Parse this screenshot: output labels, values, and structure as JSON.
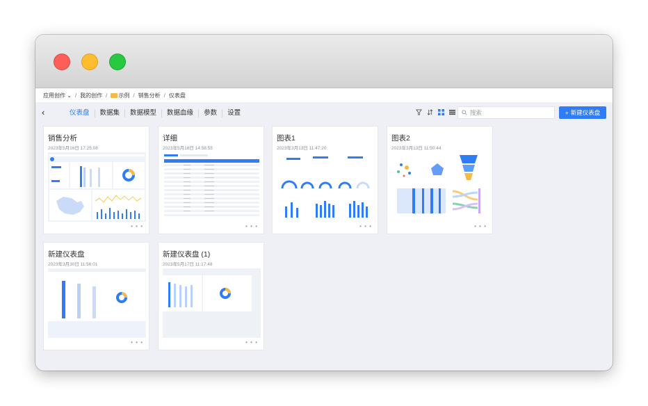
{
  "window": {
    "traffic_lights": {
      "close": "#fc5f57",
      "minimize": "#fdbd2e",
      "zoom": "#28c840"
    }
  },
  "breadcrumb": {
    "root": "应用创作",
    "items": [
      "我的创作",
      "示例",
      "销售分析",
      "仪表盘"
    ]
  },
  "toolbar": {
    "back_icon": "chevron-left-icon",
    "tabs": [
      {
        "label": "仪表盘",
        "active": true
      },
      {
        "label": "数据集",
        "active": false
      },
      {
        "label": "数据模型",
        "active": false
      },
      {
        "label": "数据血缘",
        "active": false
      },
      {
        "label": "参数",
        "active": false
      },
      {
        "label": "设置",
        "active": false
      }
    ],
    "search_placeholder": "搜索",
    "new_button": "新建仪表盘",
    "accent": "#2f7cf6"
  },
  "cards": [
    {
      "title": "销售分析",
      "date": "2023年5月16日 17:25:08",
      "more": "• • •"
    },
    {
      "title": "详细",
      "date": "2023年5月18日 14:58:55",
      "more": "• • •"
    },
    {
      "title": "图表1",
      "date": "2023年3月13日 11:47:20",
      "more": "• • •"
    },
    {
      "title": "图表2",
      "date": "2023年3月13日 11:50:44",
      "more": "• • •"
    },
    {
      "title": "新建仪表盘",
      "date": "2023年3月30日 11:56:01",
      "more": "• • •"
    },
    {
      "title": "新建仪表盘 (1)",
      "date": "2023年5月17日 11:17:48",
      "more": "• • •"
    }
  ]
}
